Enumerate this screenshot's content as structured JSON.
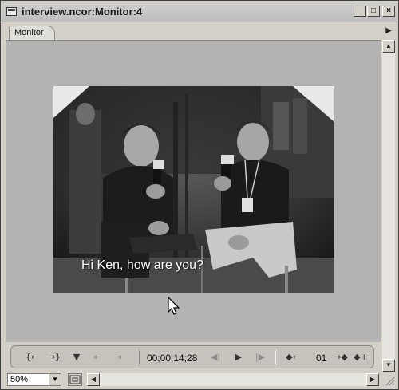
{
  "window": {
    "title": "interview.ncor:Monitor:4",
    "minimize": "_",
    "maximize": "□",
    "close": "×"
  },
  "tabs": [
    {
      "label": "Monitor"
    }
  ],
  "tab_menu_icon": "triangle-menu-icon",
  "video": {
    "caption": "Hi Ken, how are you?"
  },
  "transport": {
    "timecode": "00;00;14;28",
    "marker_value": "01",
    "buttons": [
      {
        "name": "set-in-point",
        "glyph": "{←"
      },
      {
        "name": "set-out-point",
        "glyph": "→}"
      },
      {
        "name": "set-unnumbered-marker",
        "glyph": "▼"
      },
      {
        "name": "go-to-in",
        "glyph": "⇤"
      },
      {
        "name": "go-to-out",
        "glyph": "⇥"
      },
      {
        "name": "step-back",
        "glyph": "◀|"
      },
      {
        "name": "play",
        "glyph": "▶"
      },
      {
        "name": "step-forward",
        "glyph": "|▶"
      },
      {
        "name": "previous-marker",
        "glyph": "◆←"
      },
      {
        "name": "next-marker",
        "glyph": "→◆"
      },
      {
        "name": "add-marker",
        "glyph": "◆+"
      }
    ]
  },
  "bottom": {
    "zoom_value": "50%"
  },
  "colors": {
    "panel_bg": "#b3b3b3",
    "chrome": "#d4d0c8"
  }
}
